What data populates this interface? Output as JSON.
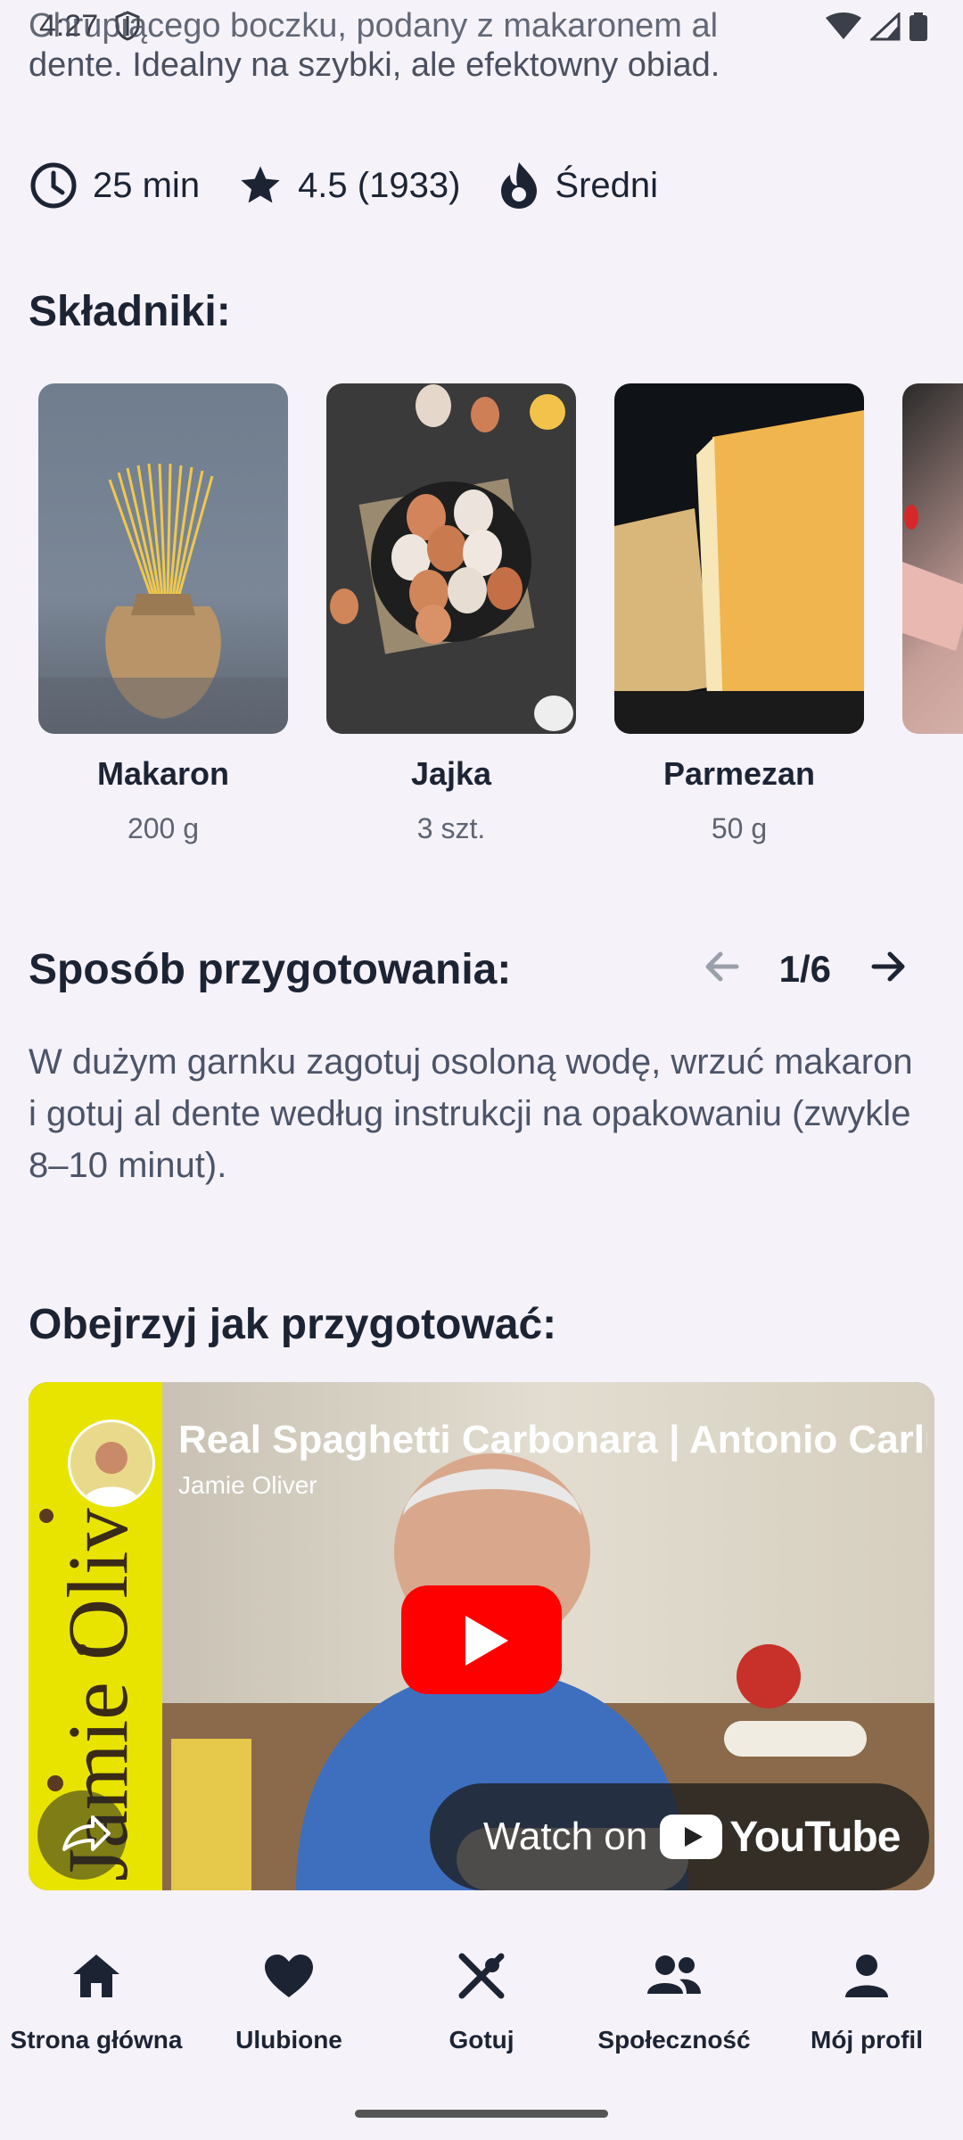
{
  "status": {
    "time": "4:27"
  },
  "recipe": {
    "description_clipped": "Chrupiącego boczku, podany z makaronem al",
    "description_visible": "dente. Idealny na szybki, ale efektowny obiad.",
    "time": "25 min",
    "rating": "4.5 (1933)",
    "difficulty": "Średni"
  },
  "ingredients": {
    "title": "Składniki:",
    "items": [
      {
        "name": "Makaron",
        "qty": "200 g"
      },
      {
        "name": "Jajka",
        "qty": "3 szt."
      },
      {
        "name": "Parmezan",
        "qty": "50 g"
      }
    ]
  },
  "preparation": {
    "title": "Sposób przygotowania:",
    "counter": "1/6",
    "step_text": "W dużym garnku zagotuj osoloną wodę, wrzuć makaron i gotuj al dente według instrukcji na opakowaniu (zwykle 8–10 minut)."
  },
  "video": {
    "section_title": "Obejrzyj jak przygotować:",
    "title": "Real Spaghetti Carbonara | Antonio Carluccio",
    "channel": "Jamie Oliver",
    "side_text": "Jamie Oliver",
    "watch_on": "Watch on",
    "youtube": "YouTube"
  },
  "bottom_nav": [
    {
      "label": "Strona główna",
      "icon": "home-icon"
    },
    {
      "label": "Ulubione",
      "icon": "heart-icon"
    },
    {
      "label": "Gotuj",
      "icon": "utensils-icon"
    },
    {
      "label": "Społeczność",
      "icon": "people-icon"
    },
    {
      "label": "Mój profil",
      "icon": "person-icon"
    }
  ]
}
